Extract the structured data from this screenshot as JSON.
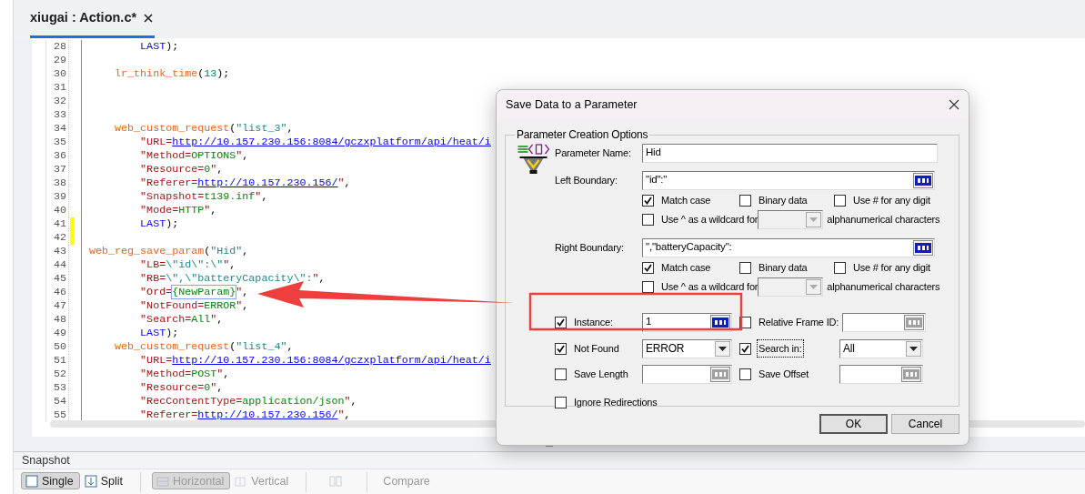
{
  "editor_tab": {
    "title": "xiugai : Action.c*",
    "selected": true
  },
  "code_lines": [
    {
      "number": "28",
      "changed": false,
      "tokens": [
        {
          "kind": "kw",
          "text": "        LAST"
        },
        {
          "kind": "p",
          "text": ");"
        }
      ]
    },
    {
      "number": "29",
      "changed": false
    },
    {
      "number": "30",
      "changed": false,
      "tokens": [
        {
          "kind": "func",
          "text": "    lr_think_time"
        },
        {
          "kind": "p",
          "text": "("
        },
        {
          "kind": "num",
          "text": "13"
        },
        {
          "kind": "p",
          "text": ");"
        }
      ]
    },
    {
      "number": "31",
      "changed": false
    },
    {
      "number": "32",
      "changed": false
    },
    {
      "number": "33",
      "changed": false
    },
    {
      "number": "34",
      "changed": false,
      "tokens": [
        {
          "kind": "func",
          "text": "    web_custom_request"
        },
        {
          "kind": "p",
          "text": "("
        },
        {
          "kind": "str",
          "text": "\"list_3\""
        },
        {
          "kind": "p",
          "text": ","
        }
      ]
    },
    {
      "number": "35",
      "changed": false,
      "tokens": [
        {
          "kind": "key",
          "text": "        \"URL="
        },
        {
          "kind": "link",
          "text": "http://10.157.230.156:8084/gczxplatform/api/heat/i"
        }
      ]
    },
    {
      "number": "36",
      "changed": false,
      "tokens": [
        {
          "kind": "key",
          "text": "        \"Method="
        },
        {
          "kind": "val",
          "text": "OPTIONS"
        },
        {
          "kind": "key",
          "text": "\""
        },
        {
          "kind": "p",
          "text": ","
        }
      ]
    },
    {
      "number": "37",
      "changed": false,
      "tokens": [
        {
          "kind": "key",
          "text": "        \"Resource="
        },
        {
          "kind": "val",
          "text": "0"
        },
        {
          "kind": "key",
          "text": "\""
        },
        {
          "kind": "p",
          "text": ","
        }
      ]
    },
    {
      "number": "38",
      "changed": false,
      "tokens": [
        {
          "kind": "key",
          "text": "        \"Referer="
        },
        {
          "kind": "link",
          "text": "http://10.157.230.156/"
        },
        {
          "kind": "key",
          "text": "\""
        },
        {
          "kind": "p",
          "text": ","
        }
      ]
    },
    {
      "number": "39",
      "changed": false,
      "tokens": [
        {
          "kind": "key",
          "text": "        \"Snapshot="
        },
        {
          "kind": "val",
          "text": "t139.inf"
        },
        {
          "kind": "key",
          "text": "\""
        },
        {
          "kind": "p",
          "text": ","
        }
      ]
    },
    {
      "number": "40",
      "changed": false,
      "tokens": [
        {
          "kind": "key",
          "text": "        \"Mode="
        },
        {
          "kind": "val",
          "text": "HTTP"
        },
        {
          "kind": "key",
          "text": "\""
        },
        {
          "kind": "p",
          "text": ","
        }
      ]
    },
    {
      "number": "41",
      "changed": true,
      "tokens": [
        {
          "kind": "kw",
          "text": "        LAST"
        },
        {
          "kind": "p",
          "text": ");"
        }
      ]
    },
    {
      "number": "42",
      "changed": true
    },
    {
      "number": "43",
      "changed": false,
      "tokens": [
        {
          "kind": "func",
          "text": "web_reg_save_param"
        },
        {
          "kind": "p",
          "text": "("
        },
        {
          "kind": "str",
          "text": "\"Hid\""
        },
        {
          "kind": "p",
          "text": ","
        }
      ]
    },
    {
      "number": "44",
      "changed": false,
      "tokens": [
        {
          "kind": "key",
          "text": "        \"LB="
        },
        {
          "kind": "str",
          "text": "\\\"id\\\":\\\""
        },
        {
          "kind": "key",
          "text": "\""
        },
        {
          "kind": "p",
          "text": ","
        }
      ]
    },
    {
      "number": "45",
      "changed": false,
      "tokens": [
        {
          "kind": "key",
          "text": "        \"RB="
        },
        {
          "kind": "str",
          "text": "\\\",\\\"batteryCapacity\\\":"
        },
        {
          "kind": "key",
          "text": "\""
        },
        {
          "kind": "p",
          "text": ","
        }
      ]
    },
    {
      "number": "46",
      "changed": false,
      "tokens": [
        {
          "kind": "key",
          "text": "        \"Ord="
        },
        {
          "kind": "param",
          "text": "{NewParam}"
        },
        {
          "kind": "key",
          "text": "\""
        },
        {
          "kind": "p",
          "text": ","
        }
      ]
    },
    {
      "number": "47",
      "changed": false,
      "tokens": [
        {
          "kind": "key",
          "text": "        \"NotFound="
        },
        {
          "kind": "val",
          "text": "ERROR"
        },
        {
          "kind": "key",
          "text": "\""
        },
        {
          "kind": "p",
          "text": ","
        }
      ]
    },
    {
      "number": "48",
      "changed": false,
      "tokens": [
        {
          "kind": "key",
          "text": "        \"Search="
        },
        {
          "kind": "val",
          "text": "All"
        },
        {
          "kind": "key",
          "text": "\""
        },
        {
          "kind": "p",
          "text": ","
        }
      ]
    },
    {
      "number": "49",
      "changed": false,
      "tokens": [
        {
          "kind": "kw",
          "text": "        LAST"
        },
        {
          "kind": "p",
          "text": ");"
        }
      ]
    },
    {
      "number": "50",
      "changed": false,
      "tokens": [
        {
          "kind": "func",
          "text": "    web_custom_request"
        },
        {
          "kind": "p",
          "text": "("
        },
        {
          "kind": "str",
          "text": "\"list_4\""
        },
        {
          "kind": "p",
          "text": ","
        }
      ]
    },
    {
      "number": "51",
      "changed": false,
      "tokens": [
        {
          "kind": "key",
          "text": "        \"URL="
        },
        {
          "kind": "link",
          "text": "http://10.157.230.156:8084/gczxplatform/api/heat/i"
        }
      ]
    },
    {
      "number": "52",
      "changed": false,
      "tokens": [
        {
          "kind": "key",
          "text": "        \"Method="
        },
        {
          "kind": "val",
          "text": "POST"
        },
        {
          "kind": "key",
          "text": "\""
        },
        {
          "kind": "p",
          "text": ","
        }
      ]
    },
    {
      "number": "53",
      "changed": false,
      "tokens": [
        {
          "kind": "key",
          "text": "        \"Resource="
        },
        {
          "kind": "val",
          "text": "0"
        },
        {
          "kind": "key",
          "text": "\""
        },
        {
          "kind": "p",
          "text": ","
        }
      ]
    },
    {
      "number": "54",
      "changed": false,
      "tokens": [
        {
          "kind": "key",
          "text": "        \"RecContentType="
        },
        {
          "kind": "val",
          "text": "application/json"
        },
        {
          "kind": "key",
          "text": "\""
        },
        {
          "kind": "p",
          "text": ","
        }
      ]
    },
    {
      "number": "55",
      "changed": false,
      "tokens": [
        {
          "kind": "key",
          "text": "        \"Referer="
        },
        {
          "kind": "link",
          "text": "http://10.157.230.156/"
        },
        {
          "kind": "key",
          "text": "\""
        },
        {
          "kind": "p",
          "text": ","
        }
      ]
    }
  ],
  "snapshot_panel": {
    "title": "Snapshot",
    "toolbar": [
      {
        "kind": "button",
        "label": "Single",
        "pressed": true,
        "disabled": false
      },
      {
        "kind": "button",
        "label": "Split",
        "pressed": false,
        "disabled": false
      },
      {
        "kind": "separator"
      },
      {
        "kind": "button",
        "label": "Horizontal",
        "pressed": true,
        "disabled": true
      },
      {
        "kind": "button",
        "label": "Vertical",
        "pressed": false,
        "disabled": true
      },
      {
        "kind": "separator"
      },
      {
        "kind": "icon",
        "pressed": false,
        "disabled": true
      },
      {
        "kind": "separator"
      },
      {
        "kind": "button",
        "label": "Compare",
        "pressed": false,
        "disabled": true
      }
    ]
  },
  "dialog": {
    "title": "Save Data to a Parameter",
    "group_title": "Parameter Creation Options",
    "parameter_name": {
      "label": "Parameter Name:",
      "value": "Hid"
    },
    "boundaries": [
      {
        "label": "Left Boundary:",
        "value": "\"id\":\"",
        "options": [
          {
            "label": "Match case",
            "checked": true
          },
          {
            "label": "Binary data",
            "checked": false
          },
          {
            "label": "Use # for any digit",
            "checked": false
          }
        ],
        "wildcard": {
          "label": "Use ^ as a wildcard for",
          "checked": false,
          "disabled": true,
          "suffix": "alphanumerical characters"
        }
      },
      {
        "label": "Right Boundary:",
        "value": "\",\"batteryCapacity\":",
        "options": [
          {
            "label": "Match case",
            "checked": true
          },
          {
            "label": "Binary data",
            "checked": false
          },
          {
            "label": "Use # for any digit",
            "checked": false
          }
        ],
        "wildcard": {
          "label": "Use ^ as a wildcard for",
          "checked": false,
          "disabled": true,
          "suffix": "alphanumerical characters"
        }
      }
    ],
    "option_rows": [
      [
        {
          "kind": "text",
          "label": "Instance:",
          "checked": true,
          "value": "1",
          "disabled": false
        },
        {
          "kind": "text",
          "label": "Relative Frame ID:",
          "checked": false,
          "disabled": true
        }
      ],
      [
        {
          "kind": "combo",
          "label": "Not Found",
          "checked": true,
          "value": "ERROR",
          "focused": false
        },
        {
          "kind": "combo",
          "label": "Search in:",
          "checked": true,
          "value": "All",
          "focused": true
        }
      ],
      [
        {
          "kind": "text",
          "label": "Save Length",
          "checked": false,
          "disabled": true
        },
        {
          "kind": "text",
          "label": "Save Offset",
          "checked": false,
          "disabled": true
        }
      ],
      [
        {
          "kind": "check",
          "label": "Ignore Redirections",
          "checked": false
        }
      ]
    ],
    "buttons": [
      {
        "label": "OK",
        "default": true
      },
      {
        "label": "Cancel",
        "default": false
      }
    ]
  }
}
